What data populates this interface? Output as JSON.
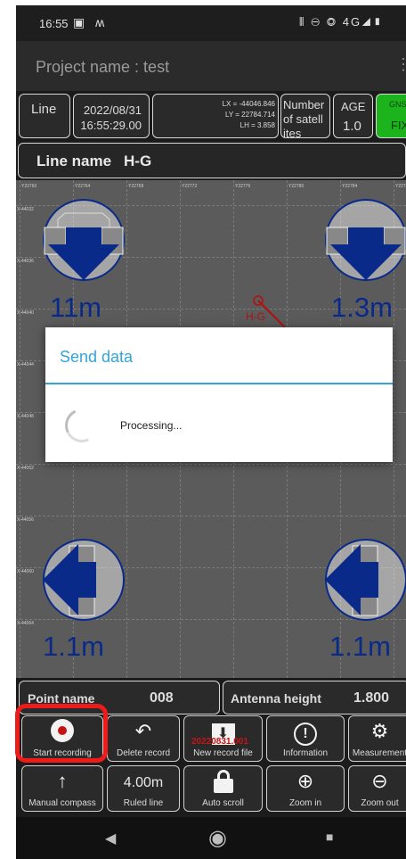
{
  "status_bar": {
    "time": "16:55",
    "left_icons": "▣ ʍ",
    "right_icons": "⫴ ⊖ ◎ 4G◢▮"
  },
  "title_bar": {
    "title": "Project name : test",
    "menu_icon": "⋮"
  },
  "info_row": {
    "mode": "Line",
    "date": "2022/08/31",
    "time": "16:55:29.00",
    "lx": "LX = -44046.846",
    "ly": "LY = 22784.714",
    "lh": "LH = 3.858",
    "satellites_label": [
      "Number",
      "of satell",
      "ites"
    ],
    "age_label": "AGE",
    "age_value": "1.0",
    "gnss_label": "GNS",
    "gnss_value": "FIX",
    "gnss_color": "#1db31d"
  },
  "line_name": {
    "label": "Line name",
    "value": "H-G"
  },
  "map": {
    "top_ticks": [
      "Y22760",
      "Y22764",
      "Y22768",
      "Y22772",
      "Y22776",
      "Y22780",
      "Y22784",
      "Y22788"
    ],
    "left_ticks": [
      "X-44032",
      "X-44036",
      "X-44040",
      "X-44044",
      "X-44048",
      "X-44052",
      "X-44056",
      "X-44060",
      "X-44064"
    ],
    "line_label": "H-G",
    "distances": {
      "top_left": "11m",
      "top_right": "1.3m",
      "bottom_left": "1.1m",
      "bottom_right": "1.1m"
    },
    "arrow_color": "#0a2a8a"
  },
  "dialog": {
    "title": "Send data",
    "message": "Processing..."
  },
  "point_row": {
    "point_label": "Point name",
    "point_value": "008",
    "antenna_label": "Antenna height",
    "antenna_value": "1.800"
  },
  "toolbar_row1": [
    {
      "label": "Start recording",
      "icon": "●"
    },
    {
      "label": "Delete record",
      "icon": "↶"
    },
    {
      "label": "New record file",
      "icon": "⬇",
      "overlay": "20220831.001"
    },
    {
      "label": "Information",
      "icon": "!"
    },
    {
      "label": "Measurement",
      "icon": "⚙"
    }
  ],
  "toolbar_row2": [
    {
      "label": "Manual compass",
      "icon": "↑"
    },
    {
      "label": "Ruled line",
      "value": "4.00m"
    },
    {
      "label": "Auto scroll",
      "icon": "🔒"
    },
    {
      "label": "Zoom in",
      "icon": "⊕"
    },
    {
      "label": "Zoom out",
      "icon": "⊖"
    }
  ],
  "nav_bar": {
    "back": "◀",
    "home": "◉",
    "recent": "■"
  }
}
